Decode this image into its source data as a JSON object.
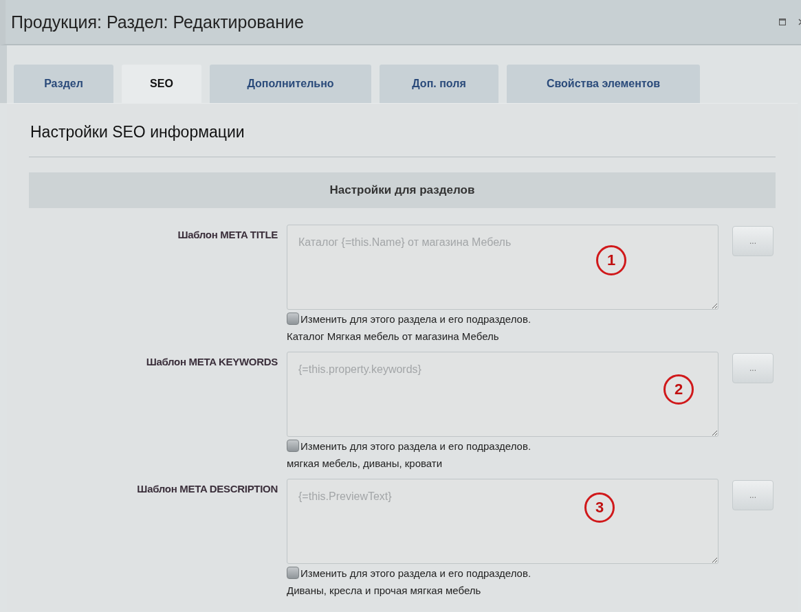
{
  "window": {
    "title": "Продукция: Раздел: Редактирование"
  },
  "tabs": [
    {
      "label": "Раздел",
      "selected": false
    },
    {
      "label": "SEO",
      "selected": true
    },
    {
      "label": "Дополнительно",
      "selected": false
    },
    {
      "label": "Доп. поля",
      "selected": false
    },
    {
      "label": "Свойства элементов",
      "selected": false
    }
  ],
  "heading": "Настройки SEO информации",
  "section": {
    "title": "Настройки для разделов"
  },
  "fields": [
    {
      "label": "Шаблон META TITLE",
      "placeholder": "Каталог {=this.Name} от магазина Мебель",
      "button": "...",
      "checkbox": {
        "label": "Изменить для этого раздела и его подразделов.",
        "checked": false
      },
      "result": "Каталог Мягкая мебель от магазина Мебель",
      "annotation": "1"
    },
    {
      "label": "Шаблон META KEYWORDS",
      "placeholder": "{=this.property.keywords}",
      "button": "...",
      "checkbox": {
        "label": "Изменить для этого раздела и его подразделов.",
        "checked": false
      },
      "result": "мягкая мебель, диваны, кровати",
      "annotation": "2"
    },
    {
      "label": "Шаблон META DESCRIPTION",
      "placeholder": "{=this.PreviewText}",
      "button": "...",
      "checkbox": {
        "label": "Изменить для этого раздела и его подразделов.",
        "checked": false
      },
      "result": "Диваны, кресла и прочая мягкая мебель",
      "annotation": "3"
    }
  ]
}
